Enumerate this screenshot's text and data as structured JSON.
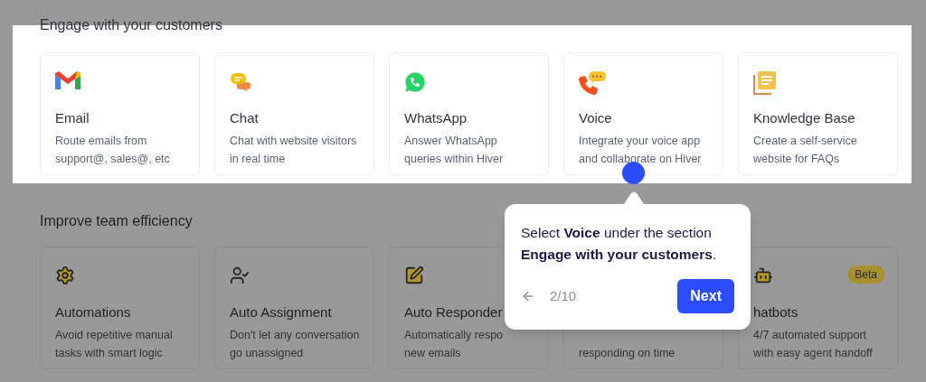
{
  "sections": [
    {
      "title": "Engage with your customers",
      "highlighted": true,
      "cards": [
        {
          "kind": "gmail",
          "title": "Email",
          "description_lines": [
            "Route emails from",
            "support@, sales@, etc"
          ]
        },
        {
          "kind": "chat",
          "title": "Chat",
          "description_lines": [
            "Chat with website visitors",
            "in real time"
          ]
        },
        {
          "kind": "whatsapp",
          "title": "WhatsApp",
          "description_lines": [
            "Answer WhatsApp",
            "queries within Hiver"
          ]
        },
        {
          "kind": "voice",
          "title": "Voice",
          "description_lines": [
            "Integrate your voice app",
            "and collaborate on Hiver"
          ]
        },
        {
          "kind": "knowledge",
          "title": "Knowledge Base",
          "description_lines": [
            "Create a self-service",
            "website for FAQs"
          ]
        }
      ]
    },
    {
      "title": "Improve team efficiency",
      "highlighted": false,
      "cards": [
        {
          "kind": "gear",
          "title": "Automations",
          "description_lines": [
            "Avoid repetitive manual",
            "tasks with smart logic"
          ]
        },
        {
          "kind": "user-check",
          "title": "Auto Assignment",
          "description_lines": [
            "Don't let any conversation",
            "go unassigned"
          ]
        },
        {
          "kind": "edit",
          "title": "Auto Responder",
          "description_lines": [
            "Automatically respo",
            "new emails"
          ]
        },
        {
          "kind": "hidden",
          "description_lines": [
            "responding on time"
          ]
        },
        {
          "kind": "bot",
          "title": "hatbots",
          "badge": "Beta",
          "description_lines": [
            "4/7 automated support",
            "with easy agent handoff"
          ]
        }
      ]
    }
  ],
  "tour": {
    "message": "Select **Voice** under the section **Engage with your customers**.",
    "step": "2/10",
    "next": "Next"
  }
}
